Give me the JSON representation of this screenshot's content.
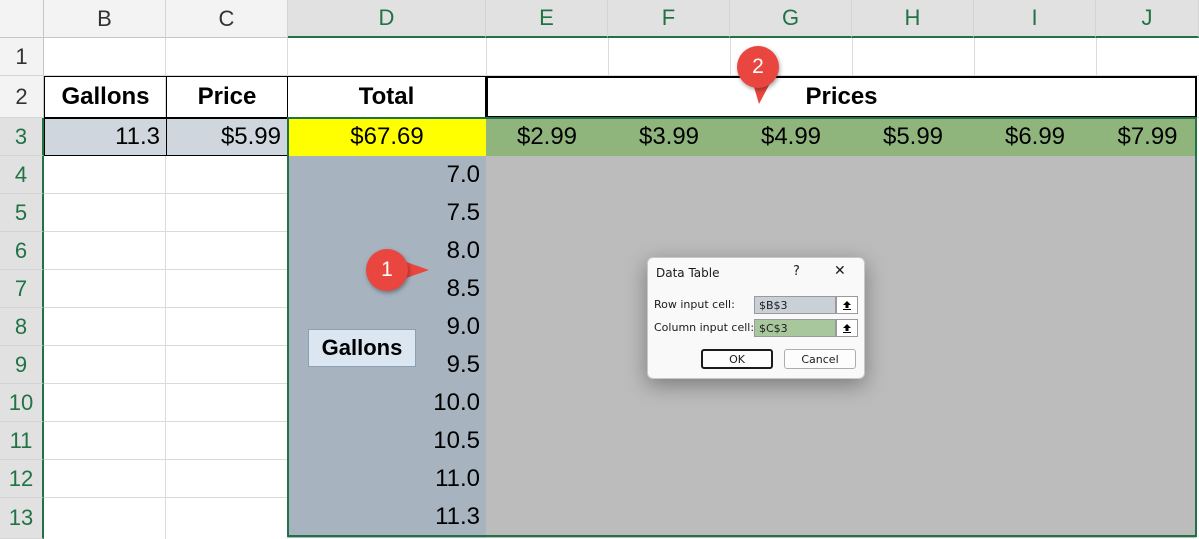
{
  "columns": [
    "B",
    "C",
    "D",
    "E",
    "F",
    "G",
    "H",
    "I",
    "J"
  ],
  "rows": [
    "1",
    "2",
    "3",
    "4",
    "5",
    "6",
    "7",
    "8",
    "9",
    "10",
    "11",
    "12",
    "13"
  ],
  "headers": {
    "gallons": "Gallons",
    "price": "Price",
    "total": "Total",
    "prices": "Prices"
  },
  "inputs": {
    "gallons": "11.3",
    "price": "$5.99"
  },
  "total_formula_value": "$67.69",
  "price_values": [
    "$2.99",
    "$3.99",
    "$4.99",
    "$5.99",
    "$6.99",
    "$7.99"
  ],
  "gallon_values": [
    "7.0",
    "7.5",
    "8.0",
    "8.5",
    "9.0",
    "9.5",
    "10.0",
    "10.5",
    "11.0",
    "11.3"
  ],
  "side_label": "Gallons",
  "callouts": [
    "1",
    "2"
  ],
  "dialog": {
    "title": "Data Table",
    "help_label": "?",
    "close_label": "✕",
    "row_label": "Row input cell:",
    "row_value": "$B$3",
    "col_label": "Column input cell:",
    "col_value": "$C$3",
    "ok_label": "OK",
    "cancel_label": "Cancel"
  },
  "colors": {
    "total_fill": "#ffff00",
    "prices_fill": "#8fb57d",
    "input_fill": "#cfd6de",
    "gallons_col_fill": "#a7b3bf",
    "table_fill": "#bcbcbc",
    "callout": "#e8463f",
    "excel_green": "#217346"
  },
  "icons": {
    "collapse": "collapse-dialog-icon"
  }
}
